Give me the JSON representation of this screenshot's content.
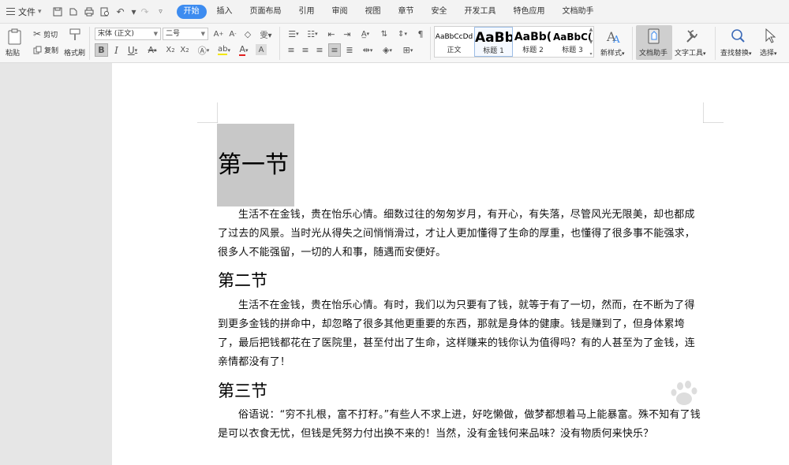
{
  "menubar": {
    "file_label": "文件",
    "tabs": [
      {
        "label": "开始",
        "active": true
      },
      {
        "label": "插入"
      },
      {
        "label": "页面布局"
      },
      {
        "label": "引用"
      },
      {
        "label": "审阅"
      },
      {
        "label": "视图"
      },
      {
        "label": "章节"
      },
      {
        "label": "安全"
      },
      {
        "label": "开发工具"
      },
      {
        "label": "特色应用"
      },
      {
        "label": "文档助手"
      }
    ]
  },
  "ribbon": {
    "paste": "粘贴",
    "cut": "剪切",
    "copy": "复制",
    "format_painter": "格式刷",
    "font_name": "宋体 (正文)",
    "font_size": "二号",
    "bold": "B",
    "italic": "I",
    "underline": "U",
    "styles": [
      {
        "preview": "AaBbCcDd",
        "name": "正文"
      },
      {
        "preview": "AaBb",
        "name": "标题 1",
        "selected": true
      },
      {
        "preview": "AaBb(",
        "name": "标题 2"
      },
      {
        "preview": "AaBbC(",
        "name": "标题 3"
      }
    ],
    "new_style": "新样式",
    "doc_helper": "文档助手",
    "text_tools": "文字工具",
    "find_replace": "查找替换",
    "select": "选择"
  },
  "document": {
    "heading1": "第一节",
    "para1": "生活不在金钱，贵在怡乐心情。细数过往的匆匆岁月，有开心，有失落，尽管风光无限美，却也都成了过去的风景。当时光从得失之间悄悄滑过，才让人更加懂得了生命的厚重，也懂得了很多事不能强求，很多人不能强留，一切的人和事，随遇而安便好。",
    "heading2": "第二节",
    "para2": "生活不在金钱，贵在怡乐心情。有时，我们以为只要有了钱，就等于有了一切，然而，在不断为了得到更多金钱的拼命中，却忽略了很多其他更重要的东西，那就是身体的健康。钱是赚到了，但身体累垮了，最后把钱都花在了医院里，甚至付出了生命，这样赚来的钱你认为值得吗？有的人甚至为了金钱，连亲情都没有了！",
    "heading3": "第三节",
    "para3": "俗语说：“穷不扎根，富不打籽。”有些人不求上进，好吃懒做，做梦都想着马上能暴富。殊不知有了钱是可以衣食无忧，但钱是凭努力付出换不来的！当然，没有金钱何来品味？没有物质何来快乐？"
  },
  "watermark": "Baidu 经验"
}
